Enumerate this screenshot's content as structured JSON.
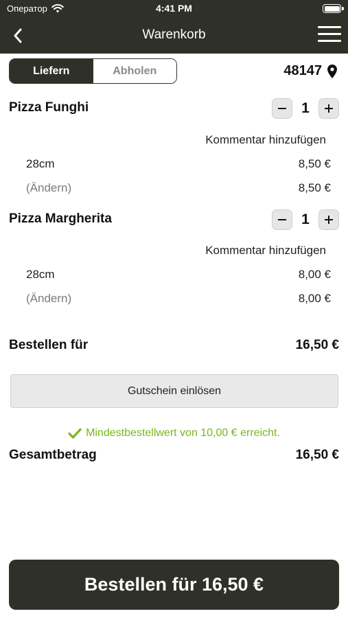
{
  "status_bar": {
    "carrier": "Оператор",
    "time": "4:41 PM"
  },
  "nav": {
    "title": "Warenkorb"
  },
  "delivery_toggle": {
    "options": [
      "Liefern",
      "Abholen"
    ],
    "selected": "Liefern"
  },
  "location": {
    "zip": "48147"
  },
  "items": [
    {
      "name": "Pizza Funghi",
      "quantity": "1",
      "comment_label": "Kommentar hinzufügen",
      "size": "28cm",
      "size_price": "8,50 €",
      "change_label": "(Ändern)",
      "item_total": "8,50 €"
    },
    {
      "name": "Pizza Margherita",
      "quantity": "1",
      "comment_label": "Kommentar hinzufügen",
      "size": "28cm",
      "size_price": "8,00 €",
      "change_label": "(Ändern)",
      "item_total": "8,00 €"
    }
  ],
  "subtotal": {
    "label": "Bestellen für",
    "value": "16,50 €"
  },
  "voucher": {
    "label": "Gutschein einlösen"
  },
  "min_order": {
    "text": "Mindestbestellwert von 10,00 € erreicht."
  },
  "total": {
    "label": "Gesamtbetrag",
    "value": "16,50 €"
  },
  "order_button": {
    "label": "Bestellen für 16,50 €"
  },
  "colors": {
    "dark": "#2f3128",
    "accent_green": "#7ab51d",
    "muted": "#7b7b7b"
  },
  "icons": [
    "wifi-icon",
    "battery-icon",
    "back-chevron-icon",
    "hamburger-menu-icon",
    "location-pin-icon",
    "minus-icon",
    "plus-icon",
    "checkmark-icon"
  ]
}
